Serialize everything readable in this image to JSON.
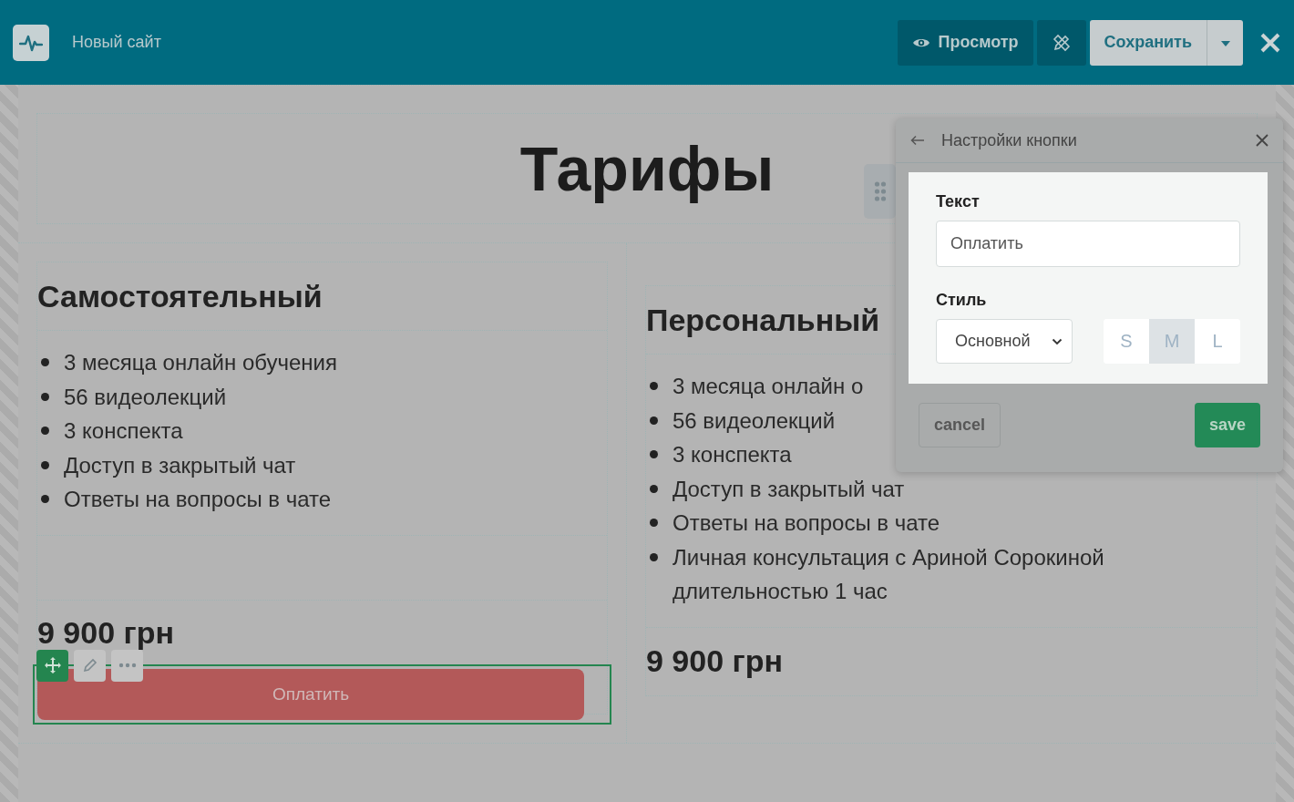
{
  "header": {
    "site_name": "Новый сайт",
    "preview_button": "Просмотр",
    "save_button": "Сохранить"
  },
  "page": {
    "title": "Тарифы",
    "plans": [
      {
        "name": "Самостоятельный",
        "features": [
          "3 месяца онлайн обучения",
          "56 видеолекций",
          "3 конспекта",
          "Доступ в закрытый чат",
          "Ответы на вопросы в чате"
        ],
        "price": "9 900 грн",
        "button": "Оплатить",
        "button_selected": true
      },
      {
        "name": "Персональный",
        "features": [
          "3 месяца онлайн о",
          "56 видеолекций",
          "3 конспекта",
          "Доступ в закрытый чат",
          "Ответы на вопросы в чате",
          "Личная консультация с Ариной Сорокиной длительностью 1 час"
        ],
        "price": "9 900 грн"
      }
    ]
  },
  "button_settings": {
    "title": "Настройки кнопки",
    "text_label": "Текст",
    "text_value": "Оплатить",
    "style_label": "Стиль",
    "style_value": "Основной",
    "sizes": [
      {
        "label": "S",
        "selected": false
      },
      {
        "label": "M",
        "selected": true
      },
      {
        "label": "L",
        "selected": false
      }
    ],
    "cancel": "cancel",
    "save": "save"
  }
}
